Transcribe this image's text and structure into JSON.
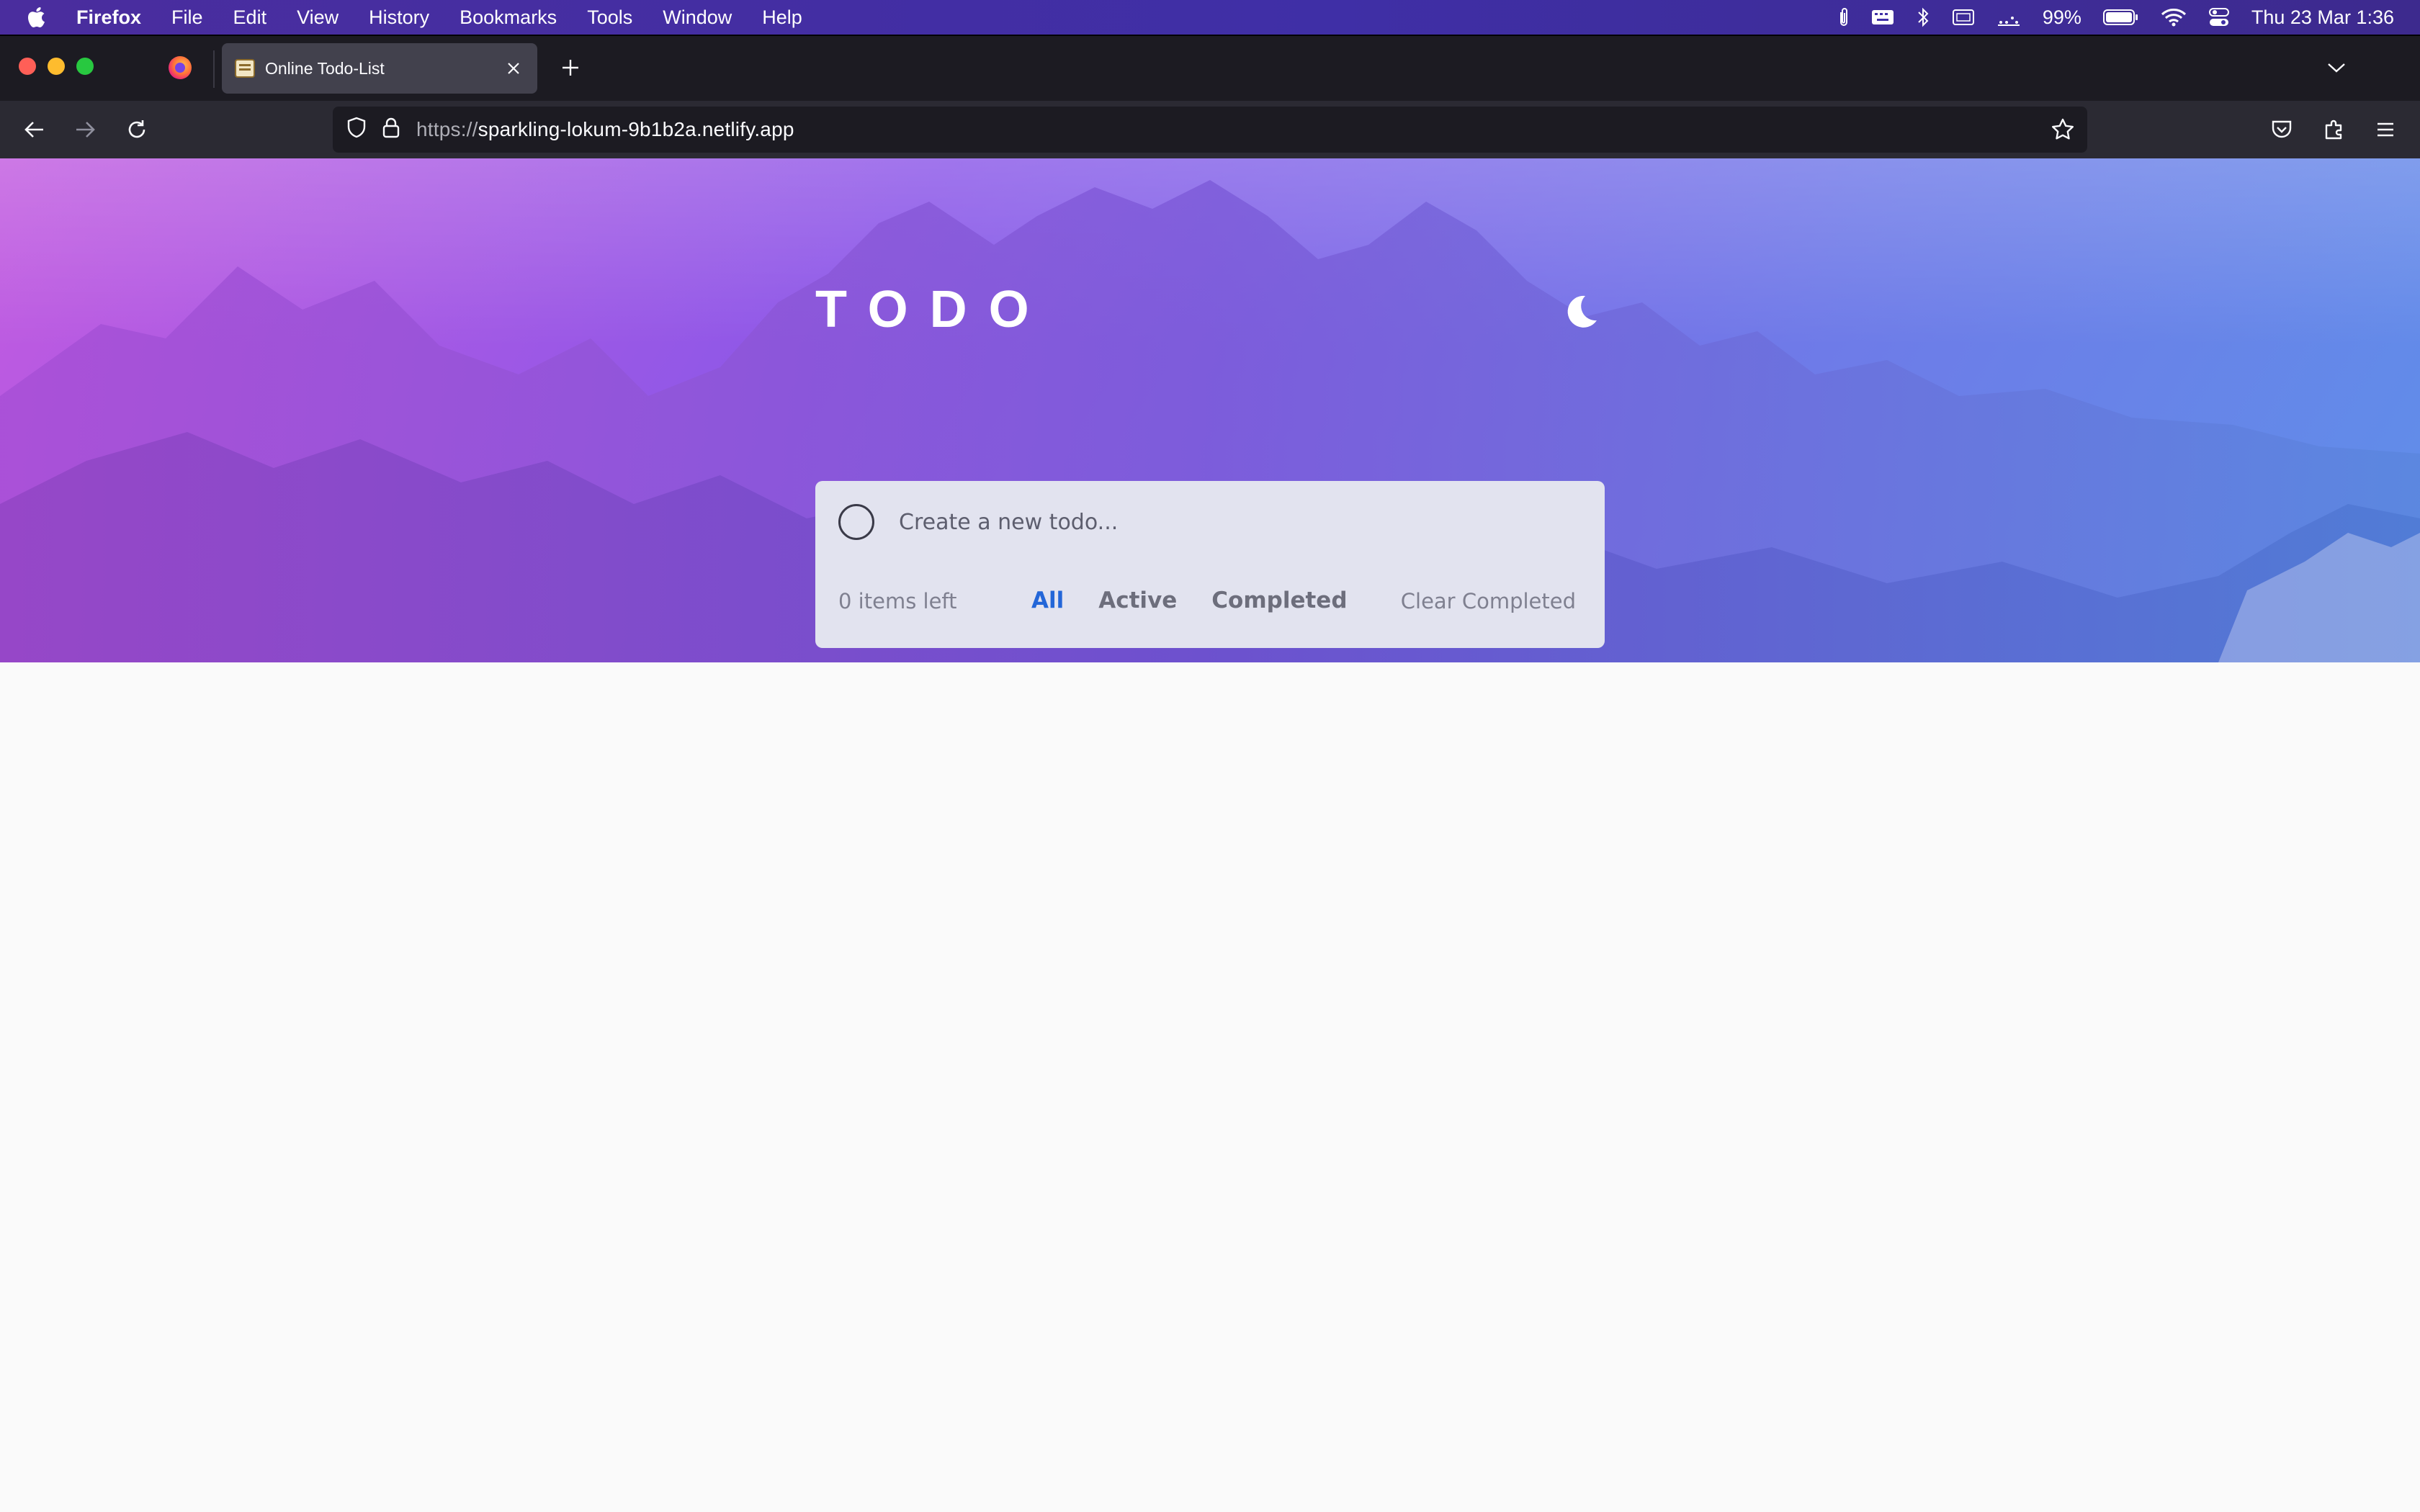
{
  "menubar": {
    "app_name": "Firefox",
    "menus": [
      "File",
      "Edit",
      "View",
      "History",
      "Bookmarks",
      "Tools",
      "Window",
      "Help"
    ],
    "battery": "99%",
    "datetime": "Thu 23 Mar  1:36"
  },
  "browser": {
    "tab_title": "Online Todo-List",
    "url_scheme": "https://",
    "url_host": "sparkling-lokum-9b1b2a.netlify.app"
  },
  "todo": {
    "title": "TODO",
    "input_placeholder": "Create a new todo...",
    "items_left": "0 items left",
    "filters": [
      "All",
      "Active",
      "Completed"
    ],
    "active_filter": "All",
    "clear_label": "Clear Completed"
  },
  "colors": {
    "accent": "#2366d8",
    "hero_start": "#c25be0",
    "hero_end": "#5f8fe9",
    "card_bg": "#e2e3ef"
  }
}
